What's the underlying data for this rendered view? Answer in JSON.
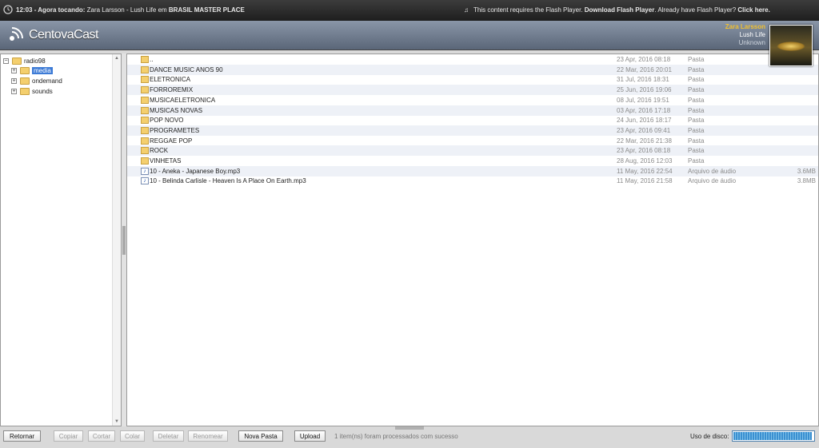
{
  "topbar": {
    "time": "12:03",
    "now_playing_label": " - Agora tocando: ",
    "song": "Zara Larsson - Lush Life",
    "em": " em ",
    "station": "BRASIL MASTER PLACE",
    "flash_text": "This content requires the Flash Player. ",
    "flash_link": "Download Flash Player",
    "flash_text2": ". Already have Flash Player? ",
    "flash_click": "Click here."
  },
  "header": {
    "brand": "CentovaCast",
    "artist": "Zara Larsson",
    "title": "Lush Life",
    "album": "Unknown"
  },
  "tree": {
    "root": "radio98",
    "children": [
      "media",
      "ondemand",
      "sounds"
    ],
    "selected": "media"
  },
  "files": [
    {
      "name": "..",
      "date": "23 Apr, 2016 08:18",
      "type": "Pasta",
      "size": "",
      "icon": "folder-icon"
    },
    {
      "name": "DANCE MUSIC ANOS 90",
      "date": "22 Mar, 2016 20:01",
      "type": "Pasta",
      "size": "",
      "icon": "folder-icon"
    },
    {
      "name": "ELETRONICA",
      "date": "31 Jul, 2016 18:31",
      "type": "Pasta",
      "size": "",
      "icon": "folder-icon"
    },
    {
      "name": "FORROREMIX",
      "date": "25 Jun, 2016 19:06",
      "type": "Pasta",
      "size": "",
      "icon": "folder-icon"
    },
    {
      "name": "MUSICAELETRONICA",
      "date": "08 Jul, 2016 19:51",
      "type": "Pasta",
      "size": "",
      "icon": "folder-icon"
    },
    {
      "name": "MUSICAS NOVAS",
      "date": "03 Apr, 2016 17:18",
      "type": "Pasta",
      "size": "",
      "icon": "folder-icon"
    },
    {
      "name": "POP NOVO",
      "date": "24 Jun, 2016 18:17",
      "type": "Pasta",
      "size": "",
      "icon": "folder-icon"
    },
    {
      "name": "PROGRAMETES",
      "date": "23 Apr, 2016 09:41",
      "type": "Pasta",
      "size": "",
      "icon": "folder-icon"
    },
    {
      "name": "REGGAE POP",
      "date": "22 Mar, 2016 21:38",
      "type": "Pasta",
      "size": "",
      "icon": "folder-icon"
    },
    {
      "name": "ROCK",
      "date": "23 Apr, 2016 08:18",
      "type": "Pasta",
      "size": "",
      "icon": "folder-icon"
    },
    {
      "name": "VINHETAS",
      "date": "28 Aug, 2016 12:03",
      "type": "Pasta",
      "size": "",
      "icon": "folder-icon"
    },
    {
      "name": "10 - Aneka - Japanese Boy.mp3",
      "date": "11 May, 2016 22:54",
      "type": "Arquivo de áudio",
      "size": "3.6MB",
      "icon": "audio-file-icon"
    },
    {
      "name": "10 - Belinda Carlisle - Heaven Is A Place On Earth.mp3",
      "date": "11 May, 2016 21:58",
      "type": "Arquivo de áudio",
      "size": "3.8MB",
      "icon": "audio-file-icon"
    }
  ],
  "toolbar": {
    "retornar": "Retornar",
    "copiar": "Copiar",
    "cortar": "Cortar",
    "colar": "Colar",
    "deletar": "Deletar",
    "renomear": "Renomear",
    "nova_pasta": "Nova Pasta",
    "upload": "Upload",
    "status": "1 item(ns) foram processados com sucesso",
    "disk_label": "Uso de disco:",
    "disk_usage_fraction": 0.98
  }
}
